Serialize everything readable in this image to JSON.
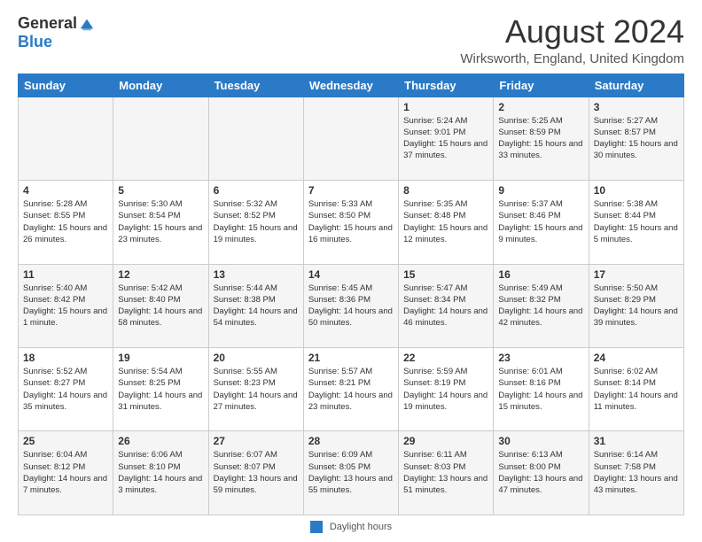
{
  "logo": {
    "general": "General",
    "blue": "Blue"
  },
  "title": "August 2024",
  "location": "Wirksworth, England, United Kingdom",
  "days_of_week": [
    "Sunday",
    "Monday",
    "Tuesday",
    "Wednesday",
    "Thursday",
    "Friday",
    "Saturday"
  ],
  "weeks": [
    [
      {
        "day": "",
        "info": ""
      },
      {
        "day": "",
        "info": ""
      },
      {
        "day": "",
        "info": ""
      },
      {
        "day": "",
        "info": ""
      },
      {
        "day": "1",
        "info": "Sunrise: 5:24 AM\nSunset: 9:01 PM\nDaylight: 15 hours and 37 minutes."
      },
      {
        "day": "2",
        "info": "Sunrise: 5:25 AM\nSunset: 8:59 PM\nDaylight: 15 hours and 33 minutes."
      },
      {
        "day": "3",
        "info": "Sunrise: 5:27 AM\nSunset: 8:57 PM\nDaylight: 15 hours and 30 minutes."
      }
    ],
    [
      {
        "day": "4",
        "info": "Sunrise: 5:28 AM\nSunset: 8:55 PM\nDaylight: 15 hours and 26 minutes."
      },
      {
        "day": "5",
        "info": "Sunrise: 5:30 AM\nSunset: 8:54 PM\nDaylight: 15 hours and 23 minutes."
      },
      {
        "day": "6",
        "info": "Sunrise: 5:32 AM\nSunset: 8:52 PM\nDaylight: 15 hours and 19 minutes."
      },
      {
        "day": "7",
        "info": "Sunrise: 5:33 AM\nSunset: 8:50 PM\nDaylight: 15 hours and 16 minutes."
      },
      {
        "day": "8",
        "info": "Sunrise: 5:35 AM\nSunset: 8:48 PM\nDaylight: 15 hours and 12 minutes."
      },
      {
        "day": "9",
        "info": "Sunrise: 5:37 AM\nSunset: 8:46 PM\nDaylight: 15 hours and 9 minutes."
      },
      {
        "day": "10",
        "info": "Sunrise: 5:38 AM\nSunset: 8:44 PM\nDaylight: 15 hours and 5 minutes."
      }
    ],
    [
      {
        "day": "11",
        "info": "Sunrise: 5:40 AM\nSunset: 8:42 PM\nDaylight: 15 hours and 1 minute."
      },
      {
        "day": "12",
        "info": "Sunrise: 5:42 AM\nSunset: 8:40 PM\nDaylight: 14 hours and 58 minutes."
      },
      {
        "day": "13",
        "info": "Sunrise: 5:44 AM\nSunset: 8:38 PM\nDaylight: 14 hours and 54 minutes."
      },
      {
        "day": "14",
        "info": "Sunrise: 5:45 AM\nSunset: 8:36 PM\nDaylight: 14 hours and 50 minutes."
      },
      {
        "day": "15",
        "info": "Sunrise: 5:47 AM\nSunset: 8:34 PM\nDaylight: 14 hours and 46 minutes."
      },
      {
        "day": "16",
        "info": "Sunrise: 5:49 AM\nSunset: 8:32 PM\nDaylight: 14 hours and 42 minutes."
      },
      {
        "day": "17",
        "info": "Sunrise: 5:50 AM\nSunset: 8:29 PM\nDaylight: 14 hours and 39 minutes."
      }
    ],
    [
      {
        "day": "18",
        "info": "Sunrise: 5:52 AM\nSunset: 8:27 PM\nDaylight: 14 hours and 35 minutes."
      },
      {
        "day": "19",
        "info": "Sunrise: 5:54 AM\nSunset: 8:25 PM\nDaylight: 14 hours and 31 minutes."
      },
      {
        "day": "20",
        "info": "Sunrise: 5:55 AM\nSunset: 8:23 PM\nDaylight: 14 hours and 27 minutes."
      },
      {
        "day": "21",
        "info": "Sunrise: 5:57 AM\nSunset: 8:21 PM\nDaylight: 14 hours and 23 minutes."
      },
      {
        "day": "22",
        "info": "Sunrise: 5:59 AM\nSunset: 8:19 PM\nDaylight: 14 hours and 19 minutes."
      },
      {
        "day": "23",
        "info": "Sunrise: 6:01 AM\nSunset: 8:16 PM\nDaylight: 14 hours and 15 minutes."
      },
      {
        "day": "24",
        "info": "Sunrise: 6:02 AM\nSunset: 8:14 PM\nDaylight: 14 hours and 11 minutes."
      }
    ],
    [
      {
        "day": "25",
        "info": "Sunrise: 6:04 AM\nSunset: 8:12 PM\nDaylight: 14 hours and 7 minutes."
      },
      {
        "day": "26",
        "info": "Sunrise: 6:06 AM\nSunset: 8:10 PM\nDaylight: 14 hours and 3 minutes."
      },
      {
        "day": "27",
        "info": "Sunrise: 6:07 AM\nSunset: 8:07 PM\nDaylight: 13 hours and 59 minutes."
      },
      {
        "day": "28",
        "info": "Sunrise: 6:09 AM\nSunset: 8:05 PM\nDaylight: 13 hours and 55 minutes."
      },
      {
        "day": "29",
        "info": "Sunrise: 6:11 AM\nSunset: 8:03 PM\nDaylight: 13 hours and 51 minutes."
      },
      {
        "day": "30",
        "info": "Sunrise: 6:13 AM\nSunset: 8:00 PM\nDaylight: 13 hours and 47 minutes."
      },
      {
        "day": "31",
        "info": "Sunrise: 6:14 AM\nSunset: 7:58 PM\nDaylight: 13 hours and 43 minutes."
      }
    ]
  ],
  "footer": {
    "legend_label": "Daylight hours"
  }
}
